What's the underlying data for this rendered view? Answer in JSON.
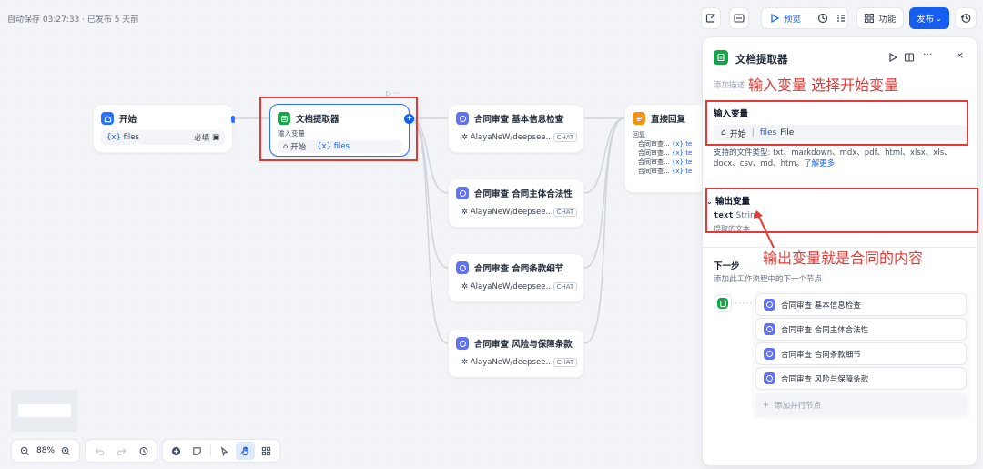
{
  "header": {
    "autosave": "自动保存 03:27:33 · 已发布 5 天前"
  },
  "toolbar": {
    "preview_label": "预览",
    "features_label": "功能",
    "publish_label": "发布"
  },
  "colors": {
    "accent": "#155eef",
    "annotation": "#e53935",
    "doc_icon": "#16a34a",
    "llm_icon": "#6172f3",
    "answer_icon": "#f79009"
  },
  "nodes": {
    "start": {
      "title": "开始",
      "var_name": "files",
      "required": "必填"
    },
    "doc": {
      "title": "文档提取器",
      "input_label": "输入变量",
      "source": "开始",
      "var_name": "files"
    },
    "llm": [
      {
        "title": "合同审查 基本信息检查",
        "model": "AlayaNeW/deepsee...",
        "tag": "CHAT"
      },
      {
        "title": "合同审查 合同主体合法性",
        "model": "AlayaNeW/deepsee...",
        "tag": "CHAT"
      },
      {
        "title": "合同审查 合同条款细节",
        "model": "AlayaNeW/deepsee...",
        "tag": "CHAT"
      },
      {
        "title": "合同审查 风险与保障条款",
        "model": "AlayaNeW/deepsee...",
        "tag": "CHAT"
      }
    ],
    "answer": {
      "title": "直接回复",
      "label": "回复",
      "rows": [
        "合同审查...",
        "合同审查...",
        "合同审查...",
        "合同审查..."
      ],
      "row_suffix": "{x} te"
    }
  },
  "annotations": {
    "input": "输入变量 选择开始变量",
    "output": "输出变量就是合同的内容"
  },
  "panel": {
    "title": "文档提取器",
    "desc_placeholder": "添加描述...",
    "input_section": "输入变量",
    "input_source": "开始",
    "input_var": "files",
    "input_type": "File",
    "support_text": "支持的文件类型: txt、markdown、mdx、pdf、html、xlsx、xls、docx、csv、md、htm。",
    "support_link": "了解更多",
    "output_section": "输出变量",
    "output_name": "text",
    "output_type": "String",
    "output_desc": "提取的文本",
    "next_title": "下一步",
    "next_desc": "添加此工作流程中的下一个节点",
    "next_nodes": [
      "合同审查 基本信息检查",
      "合同审查 合同主体合法性",
      "合同审查 合同条款细节",
      "合同审查 风险与保障条款"
    ],
    "add_parallel": "添加并行节点"
  },
  "zoom": {
    "level": "88%"
  }
}
